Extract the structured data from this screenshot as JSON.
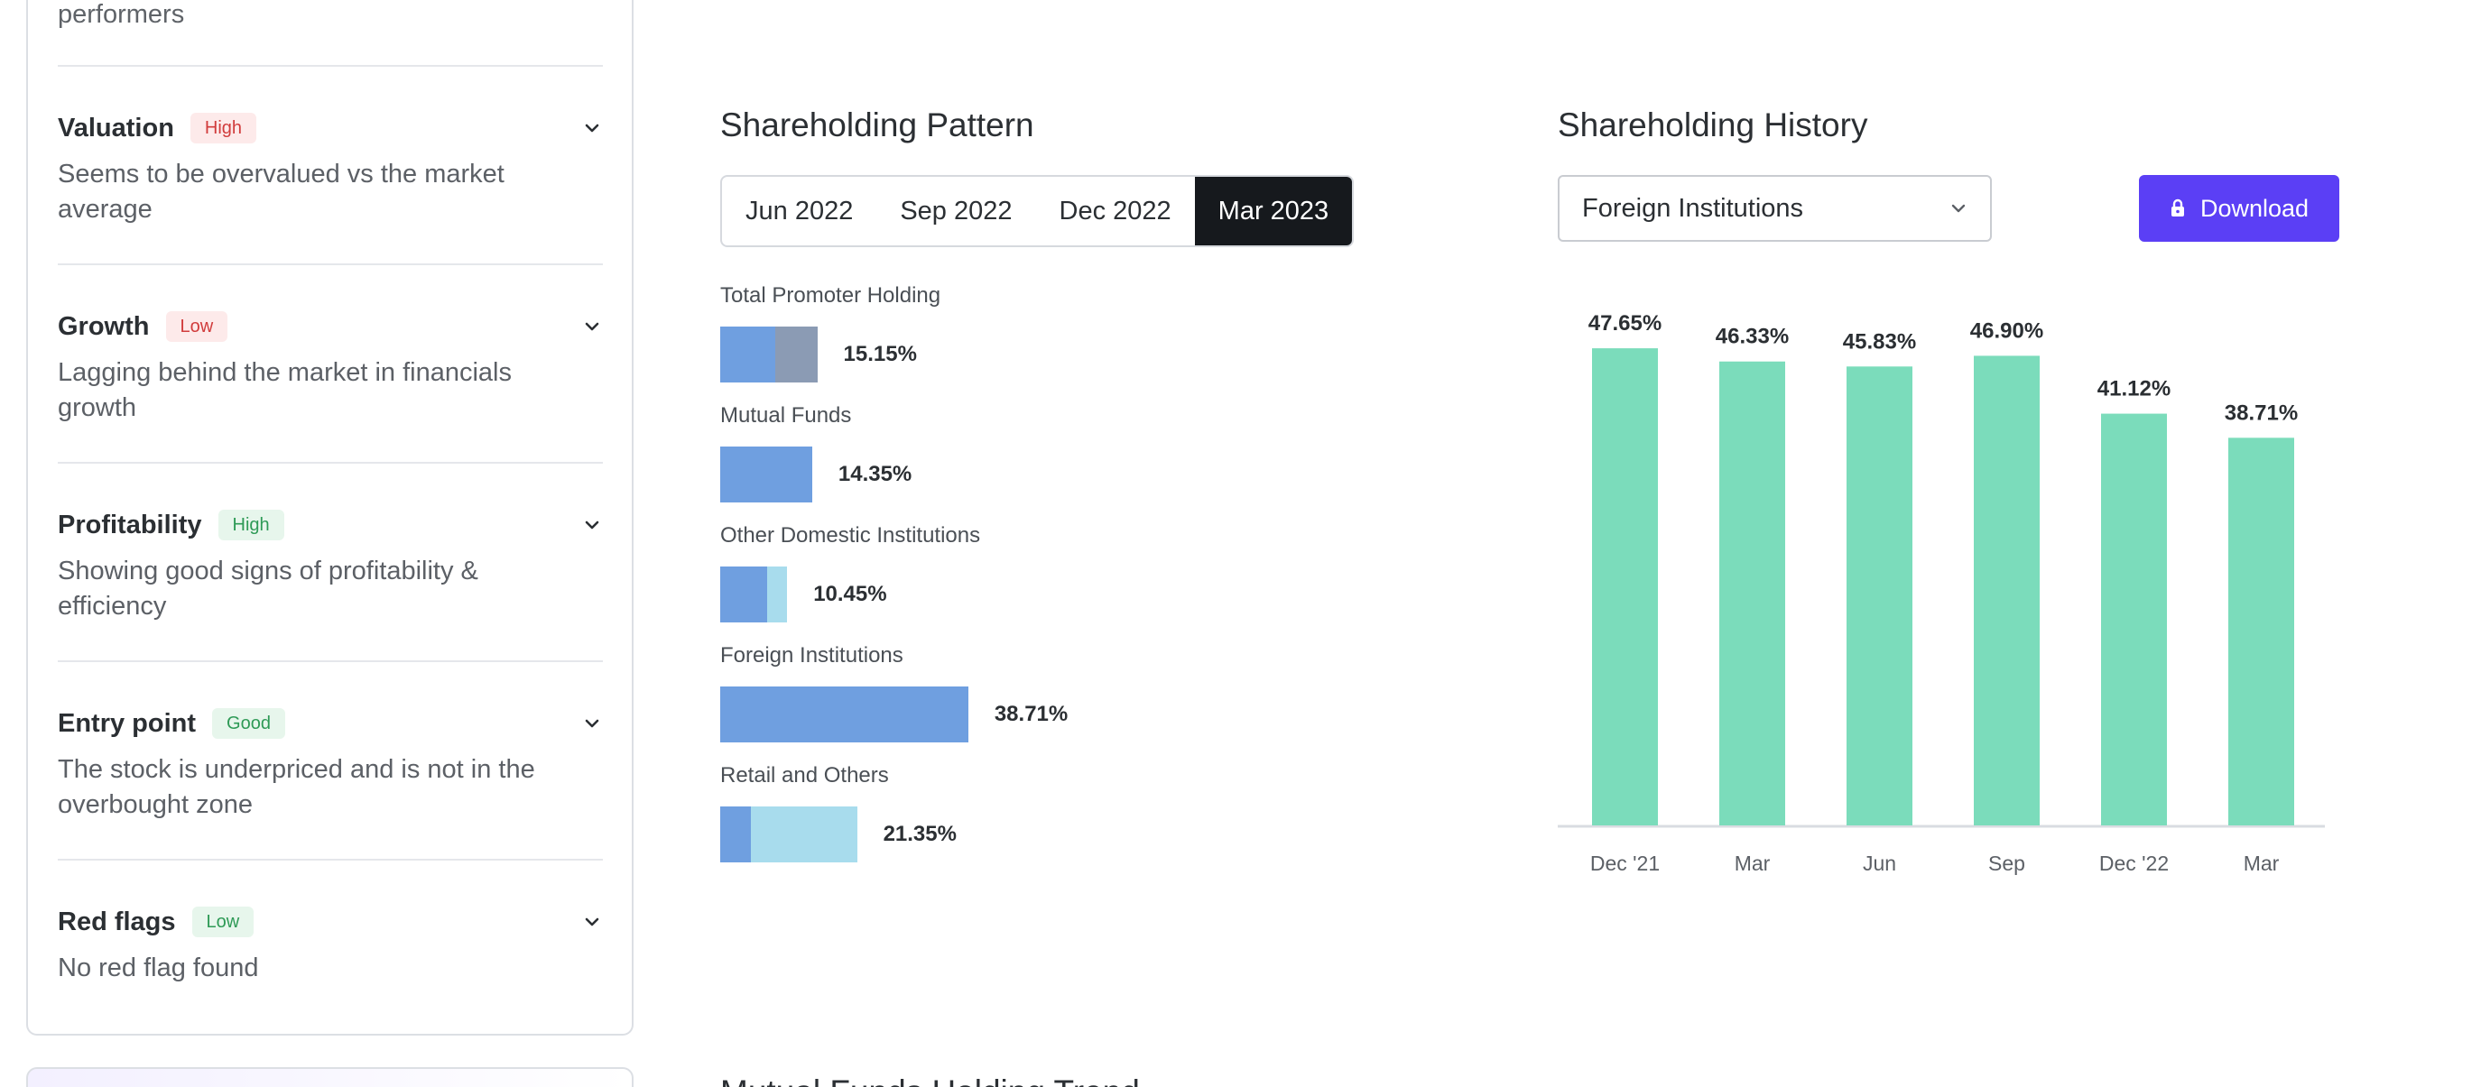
{
  "scorecard": {
    "prev_text": "performers",
    "items": [
      {
        "title": "Valuation",
        "badge": "High",
        "badge_tone": "bad",
        "description": "Seems to be overvalued vs the market average"
      },
      {
        "title": "Growth",
        "badge": "Low",
        "badge_tone": "bad",
        "description": "Lagging behind the market in financials growth"
      },
      {
        "title": "Profitability",
        "badge": "High",
        "badge_tone": "good",
        "description": "Showing good signs of profitability & efficiency"
      },
      {
        "title": "Entry point",
        "badge": "Good",
        "badge_tone": "good",
        "description": "The stock is underpriced and is not in the overbought zone"
      },
      {
        "title": "Red flags",
        "badge": "Low",
        "badge_tone": "good",
        "description": "No red flag found"
      }
    ]
  },
  "pattern": {
    "title": "Shareholding Pattern",
    "tabs": [
      "Jun 2022",
      "Sep 2022",
      "Dec 2022",
      "Mar 2023"
    ],
    "active_tab": "Mar 2023",
    "rows": [
      {
        "label": "Total Promoter Holding",
        "value": "15.15%",
        "segments": [
          {
            "pct": 8.6,
            "color": "#6f9fe0"
          },
          {
            "pct": 6.55,
            "color": "#8b9bb4"
          }
        ]
      },
      {
        "label": "Mutual Funds",
        "value": "14.35%",
        "segments": [
          {
            "pct": 14.35,
            "color": "#6f9fe0"
          }
        ]
      },
      {
        "label": "Other Domestic Institutions",
        "value": "10.45%",
        "segments": [
          {
            "pct": 7.3,
            "color": "#6f9fe0"
          },
          {
            "pct": 3.15,
            "color": "#a8dced"
          }
        ]
      },
      {
        "label": "Foreign Institutions",
        "value": "38.71%",
        "segments": [
          {
            "pct": 38.71,
            "color": "#6f9fe0"
          }
        ]
      },
      {
        "label": "Retail and Others",
        "value": "21.35%",
        "segments": [
          {
            "pct": 4.85,
            "color": "#6f9fe0"
          },
          {
            "pct": 16.5,
            "color": "#a8dced"
          }
        ]
      }
    ]
  },
  "history": {
    "title": "Shareholding History",
    "select_value": "Foreign Institutions",
    "download_label": "Download",
    "icons": {
      "lock": "lock-icon",
      "chevron": "chevron-down-icon"
    }
  },
  "chart_data": {
    "type": "bar",
    "categories": [
      "Dec '21",
      "Mar",
      "Jun",
      "Sep",
      "Dec '22",
      "Mar"
    ],
    "values": [
      47.65,
      46.33,
      45.83,
      46.9,
      41.12,
      38.71
    ],
    "value_labels": [
      "47.65%",
      "46.33%",
      "45.83%",
      "46.90%",
      "41.12%",
      "38.71%"
    ],
    "color": "#7bdcbb",
    "grid": false,
    "legend": false,
    "ylim": [
      0,
      50
    ]
  },
  "next_section": {
    "title": "Mutual Funds Holding Trend"
  }
}
